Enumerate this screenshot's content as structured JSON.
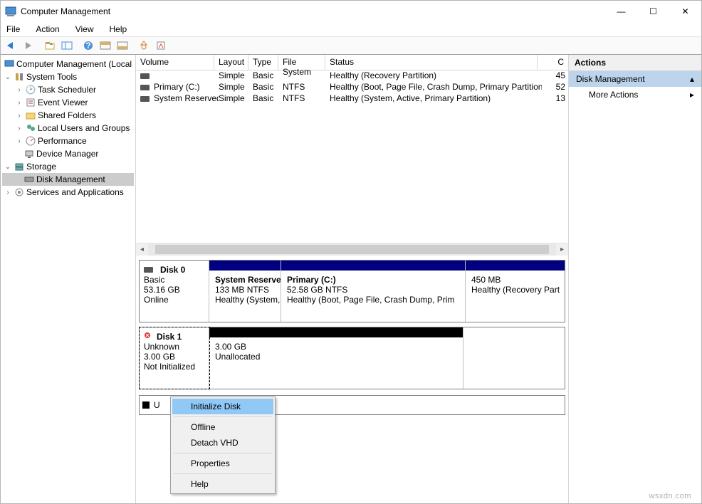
{
  "title": "Computer Management",
  "menus": [
    "File",
    "Action",
    "View",
    "Help"
  ],
  "winControls": {
    "min": "—",
    "max": "☐",
    "close": "✕"
  },
  "tree": {
    "root": "Computer Management (Local",
    "systemTools": "System Tools",
    "taskScheduler": "Task Scheduler",
    "eventViewer": "Event Viewer",
    "sharedFolders": "Shared Folders",
    "localUsers": "Local Users and Groups",
    "performance": "Performance",
    "deviceManager": "Device Manager",
    "storage": "Storage",
    "diskManagement": "Disk Management",
    "services": "Services and Applications"
  },
  "table": {
    "headers": {
      "volume": "Volume",
      "layout": "Layout",
      "type": "Type",
      "fs": "File System",
      "status": "Status",
      "c": "C"
    },
    "rows": [
      {
        "volume": "",
        "layout": "Simple",
        "type": "Basic",
        "fs": "",
        "status": "Healthy (Recovery Partition)",
        "c": "45"
      },
      {
        "volume": "Primary (C:)",
        "layout": "Simple",
        "type": "Basic",
        "fs": "NTFS",
        "status": "Healthy (Boot, Page File, Crash Dump, Primary Partition)",
        "c": "52"
      },
      {
        "volume": "System Reserved",
        "layout": "Simple",
        "type": "Basic",
        "fs": "NTFS",
        "status": "Healthy (System, Active, Primary Partition)",
        "c": "13"
      }
    ]
  },
  "disks": {
    "d0": {
      "name": "Disk 0",
      "type": "Basic",
      "size": "53.16 GB",
      "state": "Online",
      "parts": [
        {
          "name": "System Reserved",
          "line1": "133 MB NTFS",
          "line2": "Healthy (System,"
        },
        {
          "name": "Primary  (C:)",
          "line1": "52.58 GB NTFS",
          "line2": "Healthy (Boot, Page File, Crash Dump, Prim"
        },
        {
          "name": "",
          "line1": "450 MB",
          "line2": "Healthy (Recovery Part"
        }
      ]
    },
    "d1": {
      "name": "Disk 1",
      "type": "Unknown",
      "size": "3.00 GB",
      "state": "Not Initialized",
      "parts": [
        {
          "name": "",
          "line1": "3.00 GB",
          "line2": "Unallocated"
        }
      ]
    }
  },
  "legend": "U",
  "actions": {
    "header": "Actions",
    "item": "Disk Management",
    "more": "More Actions"
  },
  "ctx": {
    "init": "Initialize Disk",
    "offline": "Offline",
    "detach": "Detach VHD",
    "props": "Properties",
    "help": "Help"
  },
  "watermark": "wsxdn.com"
}
